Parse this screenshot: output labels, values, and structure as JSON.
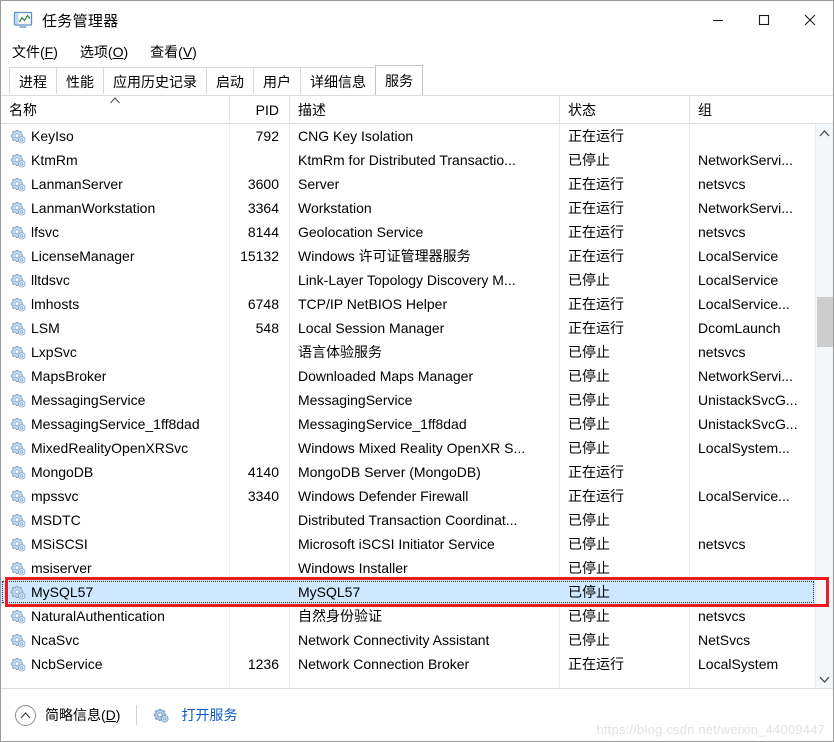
{
  "window": {
    "title": "任务管理器",
    "icon": "task-manager-icon",
    "controls": {
      "minimize": "—",
      "maximize": "□",
      "close": "✕"
    }
  },
  "menubar": {
    "items": [
      {
        "label": "文件(F)",
        "text": "文件",
        "accel": "F"
      },
      {
        "label": "选项(O)",
        "text": "选项",
        "accel": "O"
      },
      {
        "label": "查看(V)",
        "text": "查看",
        "accel": "V"
      }
    ]
  },
  "tabs": [
    {
      "label": "进程",
      "active": false
    },
    {
      "label": "性能",
      "active": false
    },
    {
      "label": "应用历史记录",
      "active": false
    },
    {
      "label": "启动",
      "active": false
    },
    {
      "label": "用户",
      "active": false
    },
    {
      "label": "详细信息",
      "active": false
    },
    {
      "label": "服务",
      "active": true
    }
  ],
  "table": {
    "columns": [
      {
        "key": "name",
        "label": "名称",
        "sorted": true,
        "sort_dir": "asc"
      },
      {
        "key": "pid",
        "label": "PID",
        "sorted": false
      },
      {
        "key": "description",
        "label": "描述",
        "sorted": false
      },
      {
        "key": "status",
        "label": "状态",
        "sorted": false
      },
      {
        "key": "group",
        "label": "组",
        "sorted": false
      }
    ],
    "rows": [
      {
        "name": "KeyIso",
        "pid": "792",
        "description": "CNG Key Isolation",
        "status": "正在运行",
        "group": ""
      },
      {
        "name": "KtmRm",
        "pid": "",
        "description": "KtmRm for Distributed Transactio...",
        "status": "已停止",
        "group": "NetworkServi..."
      },
      {
        "name": "LanmanServer",
        "pid": "3600",
        "description": "Server",
        "status": "正在运行",
        "group": "netsvcs"
      },
      {
        "name": "LanmanWorkstation",
        "pid": "3364",
        "description": "Workstation",
        "status": "正在运行",
        "group": "NetworkServi..."
      },
      {
        "name": "lfsvc",
        "pid": "8144",
        "description": "Geolocation Service",
        "status": "正在运行",
        "group": "netsvcs"
      },
      {
        "name": "LicenseManager",
        "pid": "15132",
        "description": "Windows 许可证管理器服务",
        "status": "正在运行",
        "group": "LocalService"
      },
      {
        "name": "lltdsvc",
        "pid": "",
        "description": "Link-Layer Topology Discovery M...",
        "status": "已停止",
        "group": "LocalService"
      },
      {
        "name": "lmhosts",
        "pid": "6748",
        "description": "TCP/IP NetBIOS Helper",
        "status": "正在运行",
        "group": "LocalService..."
      },
      {
        "name": "LSM",
        "pid": "548",
        "description": "Local Session Manager",
        "status": "正在运行",
        "group": "DcomLaunch"
      },
      {
        "name": "LxpSvc",
        "pid": "",
        "description": "语言体验服务",
        "status": "已停止",
        "group": "netsvcs"
      },
      {
        "name": "MapsBroker",
        "pid": "",
        "description": "Downloaded Maps Manager",
        "status": "已停止",
        "group": "NetworkServi..."
      },
      {
        "name": "MessagingService",
        "pid": "",
        "description": "MessagingService",
        "status": "已停止",
        "group": "UnistackSvcG..."
      },
      {
        "name": "MessagingService_1ff8dad",
        "pid": "",
        "description": "MessagingService_1ff8dad",
        "status": "已停止",
        "group": "UnistackSvcG..."
      },
      {
        "name": "MixedRealityOpenXRSvc",
        "pid": "",
        "description": "Windows Mixed Reality OpenXR S...",
        "status": "已停止",
        "group": "LocalSystem..."
      },
      {
        "name": "MongoDB",
        "pid": "4140",
        "description": "MongoDB Server (MongoDB)",
        "status": "正在运行",
        "group": ""
      },
      {
        "name": "mpssvc",
        "pid": "3340",
        "description": "Windows Defender Firewall",
        "status": "正在运行",
        "group": "LocalService..."
      },
      {
        "name": "MSDTC",
        "pid": "",
        "description": "Distributed Transaction Coordinat...",
        "status": "已停止",
        "group": ""
      },
      {
        "name": "MSiSCSI",
        "pid": "",
        "description": "Microsoft iSCSI Initiator Service",
        "status": "已停止",
        "group": "netsvcs"
      },
      {
        "name": "msiserver",
        "pid": "",
        "description": "Windows Installer",
        "status": "已停止",
        "group": ""
      },
      {
        "name": "MySQL57",
        "pid": "",
        "description": "MySQL57",
        "status": "已停止",
        "group": "",
        "selected": true,
        "highlighted": true
      },
      {
        "name": "NaturalAuthentication",
        "pid": "",
        "description": "自然身份验证",
        "status": "已停止",
        "group": "netsvcs"
      },
      {
        "name": "NcaSvc",
        "pid": "",
        "description": "Network Connectivity Assistant",
        "status": "已停止",
        "group": "NetSvcs"
      },
      {
        "name": "NcbService",
        "pid": "1236",
        "description": "Network Connection Broker",
        "status": "正在运行",
        "group": "LocalSystem"
      }
    ]
  },
  "scrollbar": {
    "up_arrow": "⌃",
    "down_arrow": "⌄"
  },
  "statusbar": {
    "fewer_details": "简略信息(D)",
    "fewer_details_text": "简略信息",
    "fewer_details_accel": "D",
    "open_services": "打开服务",
    "gear_icon": "services-gear-icon",
    "chevron_icon": "chevron-up-icon"
  },
  "watermark": "https://blog.csdn.net/weixin_44009447",
  "colors": {
    "selection": "#cde8ff",
    "highlight_box": "#ec1c24",
    "link": "#0b59c9",
    "scrollbar_thumb": "#cdcdcd"
  }
}
